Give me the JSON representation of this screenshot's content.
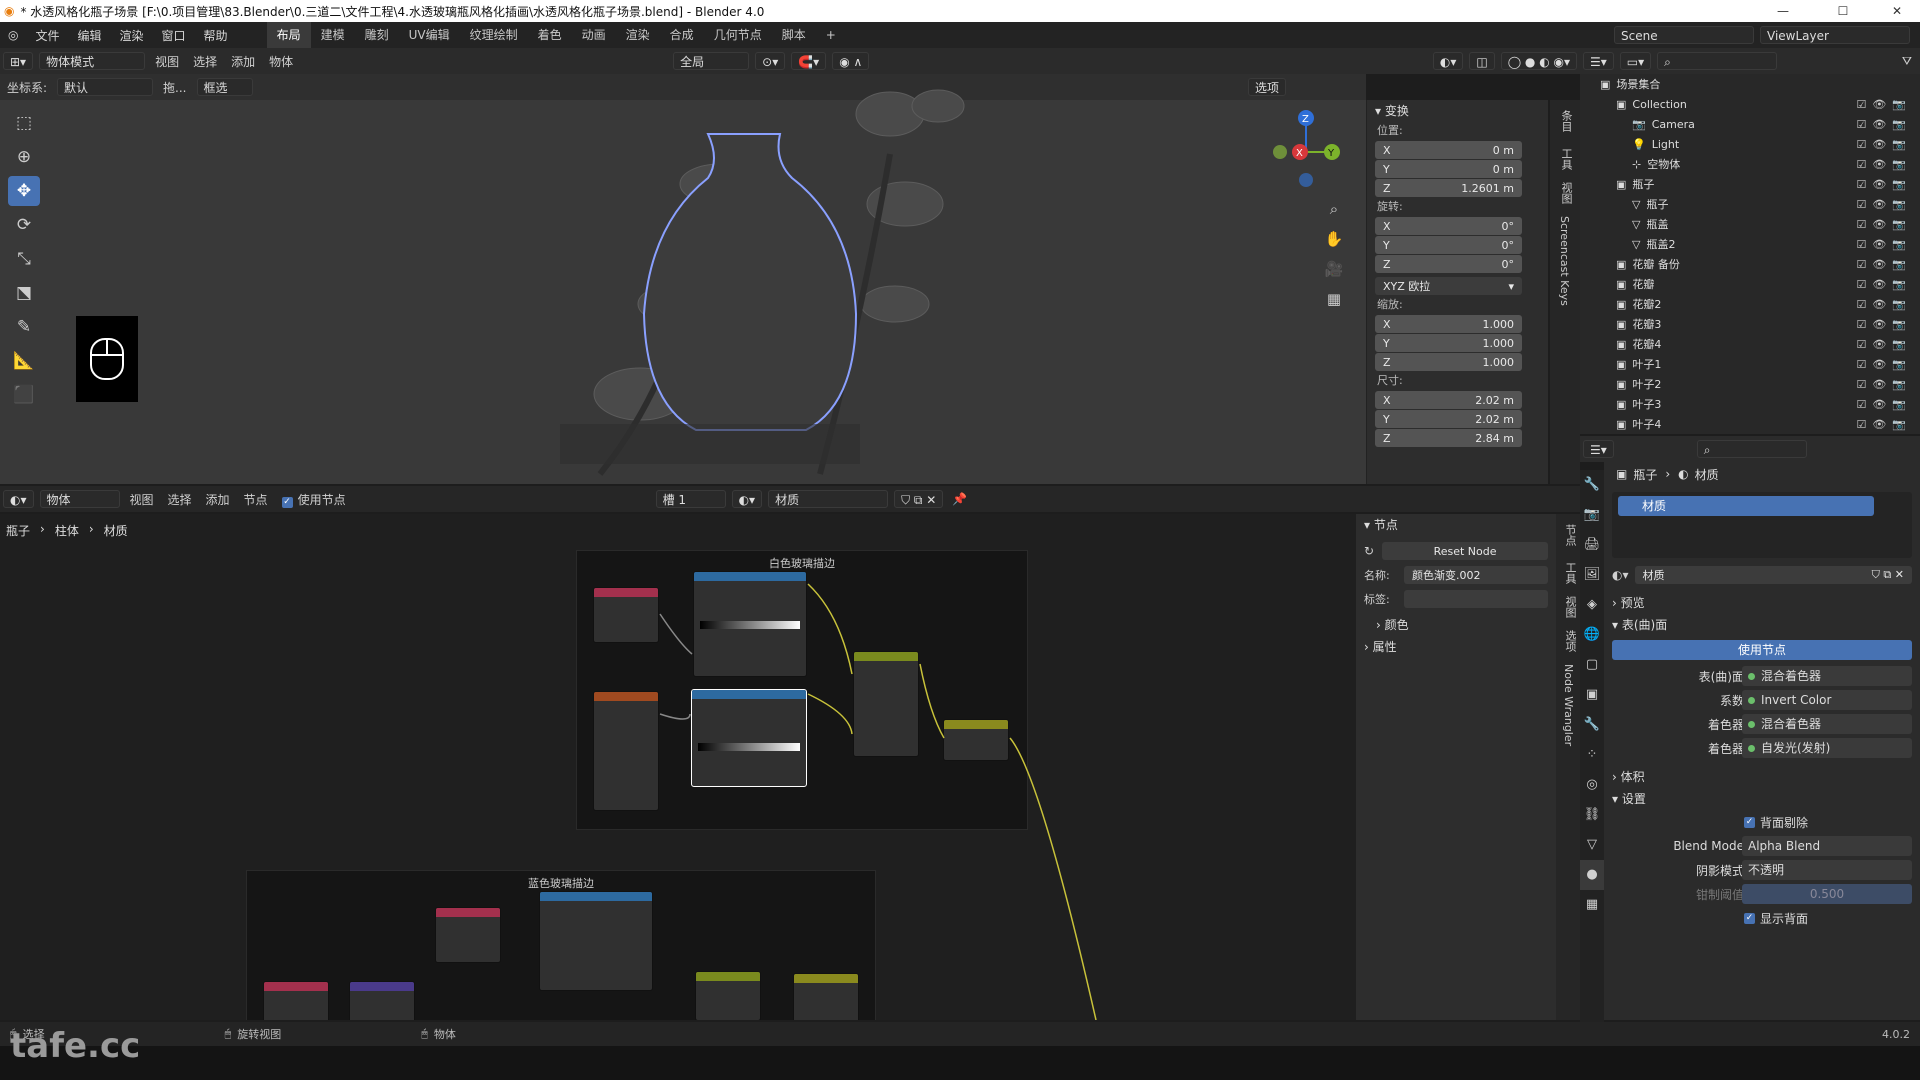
{
  "window": {
    "title": "* 水透风格化瓶子场景 [F:\\0.项目管理\\83.Blender\\0.三道二\\文件工程\\4.水透玻璃瓶风格化插画\\水透风格化瓶子场景.blend] - Blender 4.0",
    "min": "—",
    "max": "☐",
    "close": "✕"
  },
  "menubar": {
    "items": [
      "文件",
      "编辑",
      "渲染",
      "窗口",
      "帮助"
    ],
    "workspaces": [
      "布局",
      "建模",
      "雕刻",
      "UV编辑",
      "纹理绘制",
      "着色",
      "动画",
      "渲染",
      "合成",
      "几何节点",
      "脚本"
    ],
    "active_workspace": "布局",
    "add_tab": "+",
    "scene": "Scene",
    "viewlayer": "ViewLayer"
  },
  "viewport_header": {
    "mode": "物体模式",
    "menus": [
      "视图",
      "选择",
      "添加",
      "物体"
    ],
    "transform_space": "全局",
    "coord_label": "坐标系:",
    "coord_value": "默认",
    "drag_label": "拖...",
    "select_mode": "框选",
    "options": "选项"
  },
  "viewport": {
    "gizmo": {
      "z": "Z",
      "x": "X",
      "y": "Y"
    }
  },
  "transform_panel": {
    "title": "变换",
    "location_label": "位置:",
    "location": {
      "x": "0 m",
      "y": "0 m",
      "z": "1.2601 m"
    },
    "rotation_label": "旋转:",
    "rotation": {
      "x": "0°",
      "y": "0°",
      "z": "0°"
    },
    "rotation_mode": "XYZ 欧拉",
    "scale_label": "缩放:",
    "scale": {
      "x": "1.000",
      "y": "1.000",
      "z": "1.000"
    },
    "dimensions_label": "尺寸:",
    "dimensions": {
      "x": "2.02 m",
      "y": "2.02 m",
      "z": "2.84 m"
    },
    "axis": {
      "x": "X",
      "y": "Y",
      "z": "Z"
    }
  },
  "side_tabs": [
    "条目",
    "工具",
    "视图",
    "Screencast Keys"
  ],
  "outliner": {
    "root": "场景集合",
    "rows": [
      {
        "name": "Collection",
        "indent": 1,
        "kind": "collection"
      },
      {
        "name": "Camera",
        "indent": 2,
        "kind": "camera"
      },
      {
        "name": "Light",
        "indent": 2,
        "kind": "light"
      },
      {
        "name": "空物体",
        "indent": 2,
        "kind": "empty"
      },
      {
        "name": "瓶子",
        "indent": 1,
        "kind": "collection"
      },
      {
        "name": "瓶子",
        "indent": 2,
        "kind": "mesh"
      },
      {
        "name": "瓶盖",
        "indent": 2,
        "kind": "mesh"
      },
      {
        "name": "瓶盖2",
        "indent": 2,
        "kind": "mesh"
      },
      {
        "name": "花瓣 备份",
        "indent": 1,
        "kind": "collection"
      },
      {
        "name": "花瓣",
        "indent": 1,
        "kind": "collection"
      },
      {
        "name": "花瓣2",
        "indent": 1,
        "kind": "collection"
      },
      {
        "name": "花瓣3",
        "indent": 1,
        "kind": "collection"
      },
      {
        "name": "花瓣4",
        "indent": 1,
        "kind": "collection"
      },
      {
        "name": "叶子1",
        "indent": 1,
        "kind": "collection"
      },
      {
        "name": "叶子2",
        "indent": 1,
        "kind": "collection"
      },
      {
        "name": "叶子3",
        "indent": 1,
        "kind": "collection"
      },
      {
        "name": "叶子4",
        "indent": 1,
        "kind": "collection"
      }
    ]
  },
  "node_header": {
    "editor": "物体",
    "menus": [
      "视图",
      "选择",
      "添加",
      "节点"
    ],
    "use_nodes": "使用节点",
    "slot": "槽 1",
    "material": "材质"
  },
  "node_breadcrumb": [
    "瓶子",
    "柱体",
    "材质"
  ],
  "node_frames": {
    "white": "白色玻璃描边",
    "blue": "蓝色玻璃描边"
  },
  "node_sidebar": {
    "section_node": "节点",
    "reset": "Reset Node",
    "name_label": "名称:",
    "name_value": "颜色渐变.002",
    "label_label": "标签:",
    "color": "颜色",
    "properties": "属性",
    "tabs": [
      "节点",
      "工具",
      "视图",
      "选项",
      "Node Wrangler"
    ]
  },
  "properties": {
    "breadcrumb": [
      "瓶子",
      "材质"
    ],
    "slot_name": "材质",
    "material_name": "材质",
    "preview": "预览",
    "surface": "表(曲)面",
    "use_nodes": "使用节点",
    "rows": [
      {
        "label": "表(曲)面",
        "value": "混合着色器"
      },
      {
        "label": "系数",
        "value": "Invert Color"
      },
      {
        "label": "着色器",
        "value": "混合着色器"
      },
      {
        "label": "着色器",
        "value": "自发光(发射)"
      }
    ],
    "volume": "体积",
    "settings": "设置",
    "backface_culling": "背面剔除",
    "blend_mode_label": "Blend Mode",
    "blend_mode": "Alpha Blend",
    "shadow_mode_label": "阴影模式",
    "shadow_mode": "不透明",
    "clip_label": "钳制阈值",
    "clip_value": "0.500",
    "show_backface": "显示背面"
  },
  "statusbar": {
    "select": "选择",
    "rotate": "旋转视图",
    "object": "物体",
    "version": "4.0.2"
  },
  "watermark": "tafe.cc",
  "colors": {
    "accent": "#4772b3",
    "bg": "#1d1d1d",
    "viewport": "#393939"
  }
}
